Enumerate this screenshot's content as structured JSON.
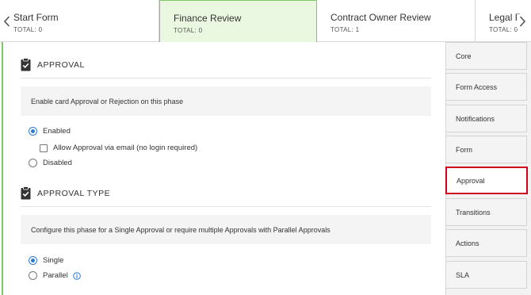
{
  "phases": [
    {
      "name": "Start Form",
      "total": "TOTAL: 0"
    },
    {
      "name": "Finance Review",
      "total": "TOTAL: 0"
    },
    {
      "name": "Contract Owner Review",
      "total": "TOTAL: 1"
    },
    {
      "name": "Legal Re",
      "total": "TOTAL: 0"
    }
  ],
  "active_phase": "Finance Review",
  "approval": {
    "title": "APPROVAL",
    "description": "Enable card Approval or Rejection on this phase",
    "options": {
      "enabled": "Enabled",
      "email_approval": "Allow Approval via email (no login required)",
      "disabled": "Disabled"
    },
    "selected": "Enabled",
    "email_approval_checked": false
  },
  "approval_type": {
    "title": "APPROVAL TYPE",
    "description": "Configure this phase for a Single Approval or require multiple Approvals with Parallel Approvals",
    "options": {
      "single": "Single",
      "parallel": "Parallel"
    },
    "selected": "Single"
  },
  "sidenav": {
    "items": [
      "Core",
      "Form Access",
      "Notifications",
      "Form",
      "Approval",
      "Transitions",
      "Actions",
      "SLA"
    ],
    "active": "Approval"
  },
  "colors": {
    "active_phase_bg": "#eaf8e1",
    "active_phase_border": "#7fc765",
    "radio_selected": "#2e7bd6",
    "nav_highlight": "#d0021b",
    "info_icon": "#2e7bd6"
  },
  "icons": [
    "chevron-left-icon",
    "chevron-right-icon",
    "clipboard-check-icon",
    "info-icon"
  ]
}
